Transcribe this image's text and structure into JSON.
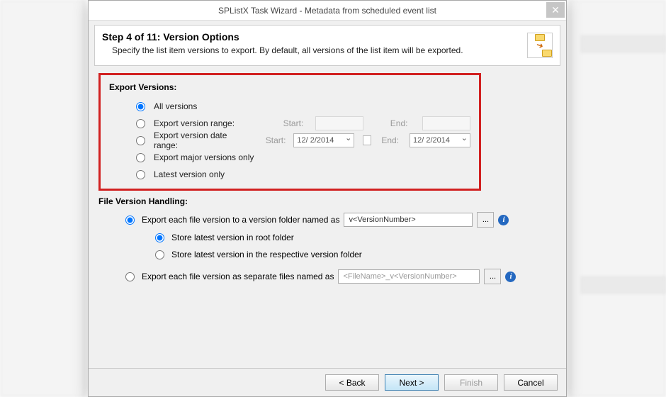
{
  "dialog": {
    "title": "SPListX Task Wizard - Metadata from scheduled event list",
    "step_heading": "Step 4 of 11: Version Options",
    "step_desc": "Specify the list item versions to export. By default, all versions of the list item will be exported."
  },
  "export_versions": {
    "legend": "Export Versions:",
    "opt_all": "All versions",
    "opt_range": "Export version range:",
    "range_start_lbl": "Start:",
    "range_start_val": "",
    "range_end_lbl": "End:",
    "range_end_val": "",
    "opt_date_range": "Export version date range:",
    "date_start_lbl": "Start:",
    "date_start_val": "12/ 2/2014",
    "date_end_lbl": "End:",
    "date_end_val": "12/ 2/2014",
    "opt_major": "Export major versions only",
    "opt_latest": "Latest version only"
  },
  "file_version_handling": {
    "legend": "File Version Handling:",
    "opt_folder": "Export each file version to a version folder named as",
    "folder_pattern": "v<VersionNumber>",
    "sub_root": "Store latest version in root folder",
    "sub_respective": "Store latest version in the respective version folder",
    "opt_files": "Export each file version as separate files named as",
    "files_pattern": "<FileName>_v<VersionNumber>",
    "browse_label": "..."
  },
  "buttons": {
    "back": "< Back",
    "next": "Next >",
    "finish": "Finish",
    "cancel": "Cancel"
  }
}
